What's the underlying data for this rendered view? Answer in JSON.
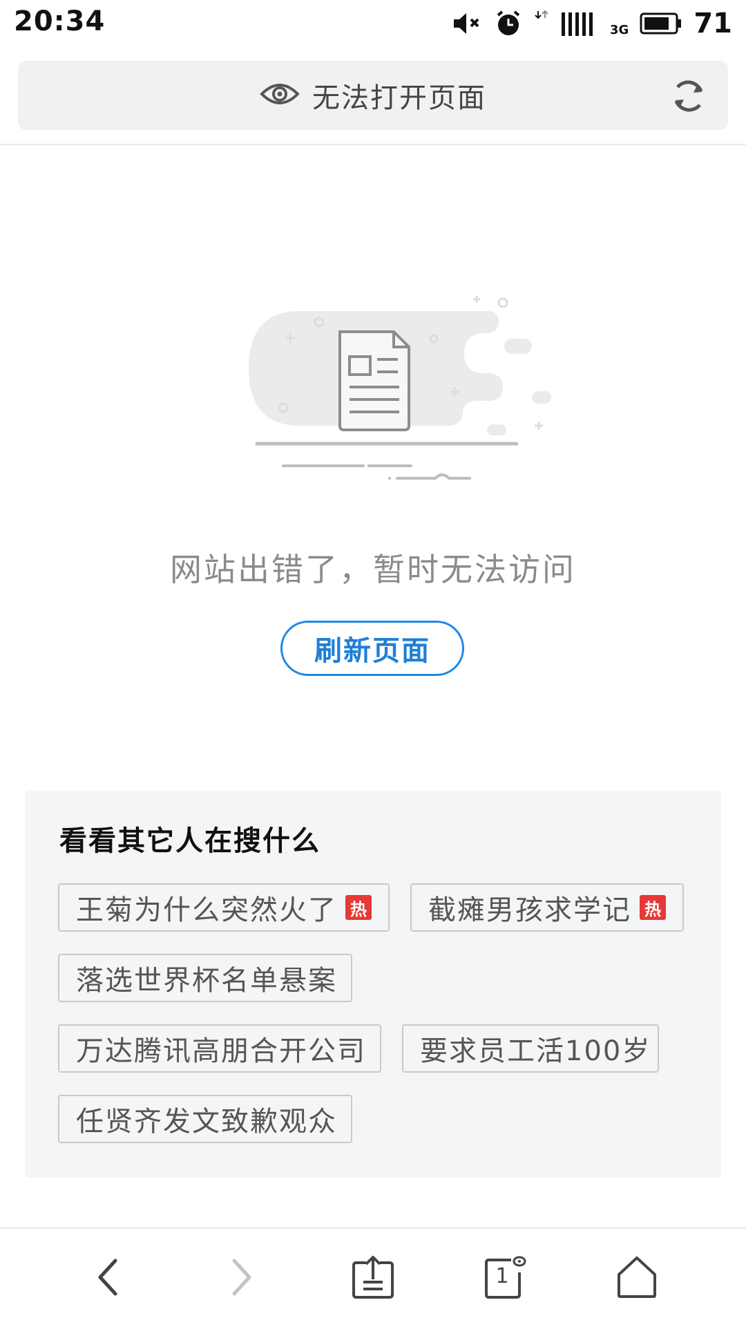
{
  "status_bar": {
    "time": "20:34",
    "network_type": "3G",
    "battery_level": "71",
    "icons": [
      "mute-icon",
      "alarm-icon",
      "data-transfer-icon",
      "signal-icon",
      "battery-icon"
    ]
  },
  "address_bar": {
    "title": "无法打开页面",
    "eye_icon": "eye-icon",
    "reload_icon": "reload-icon"
  },
  "error": {
    "message": "网站出错了，暂时无法访问",
    "refresh_label": "刷新页面"
  },
  "trending": {
    "title": "看看其它人在搜什么",
    "hot_label": "热",
    "tags": [
      {
        "text": "王菊为什么突然火了",
        "hot": true
      },
      {
        "text": "截瘫男孩求学记",
        "hot": true
      },
      {
        "text": "落选世界杯名单悬案",
        "hot": false
      },
      {
        "text": "万达腾讯高朋合开公司",
        "hot": false
      },
      {
        "text": "要求员工活100岁",
        "hot": false
      },
      {
        "text": "任贤齐发文致歉观众",
        "hot": false
      }
    ]
  },
  "bottom_nav": {
    "tab_count": "1",
    "icons": [
      "back-icon",
      "forward-icon",
      "share-icon",
      "tabs-icon",
      "home-icon"
    ]
  },
  "colors": {
    "accent": "#1e88e5",
    "hot_badge": "#e53935",
    "panel_bg": "#f4f5f7",
    "address_bg": "#f1f1f1"
  }
}
